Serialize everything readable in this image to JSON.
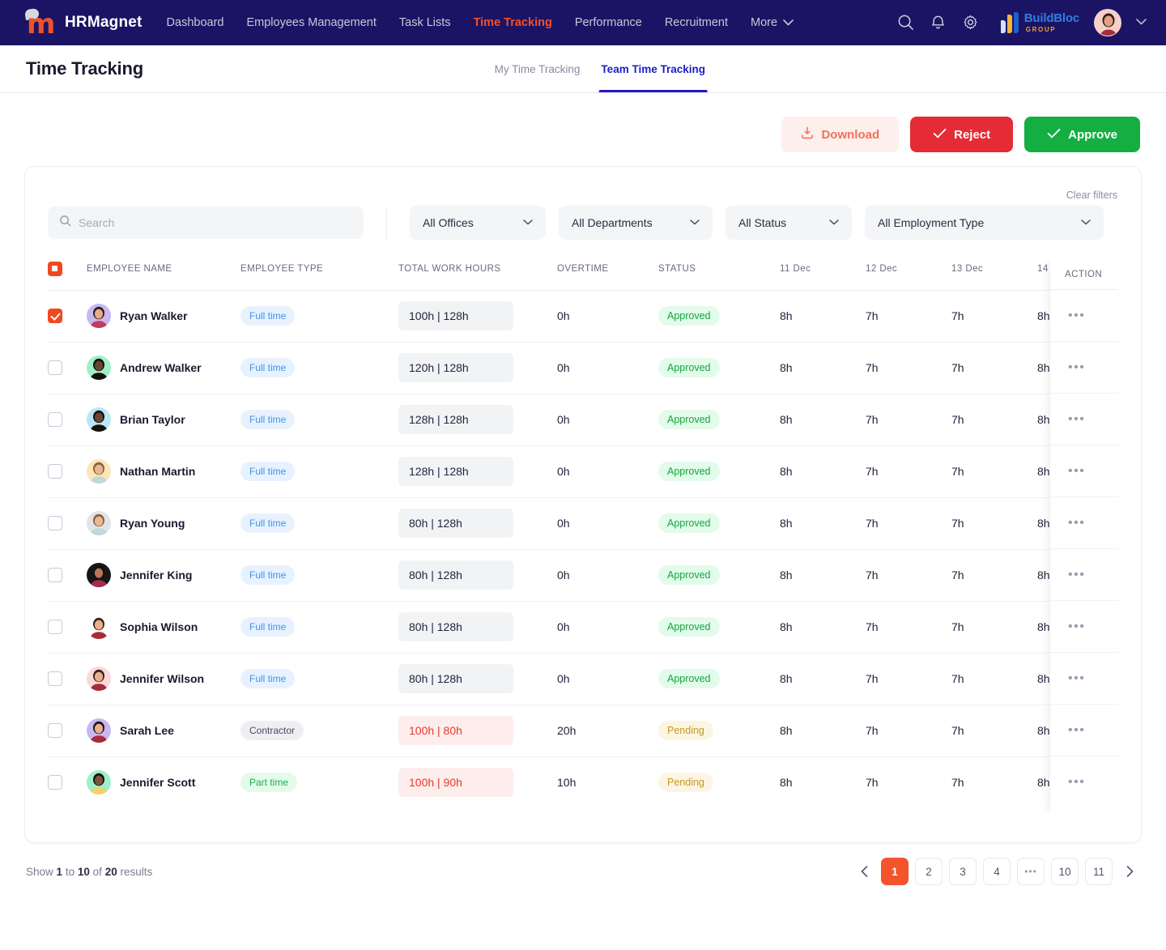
{
  "navbar": {
    "brand": "HRMagnet",
    "links": [
      {
        "label": "Dashboard",
        "active": false
      },
      {
        "label": "Employees Management",
        "active": false
      },
      {
        "label": "Task Lists",
        "active": false
      },
      {
        "label": "Time Tracking",
        "active": true
      },
      {
        "label": "Performance",
        "active": false
      },
      {
        "label": "Recruitment",
        "active": false
      }
    ],
    "more_label": "More",
    "org": {
      "name": "BuildBloc",
      "sub": "GROUP"
    },
    "accent": "#F0512C",
    "background": "#1B1464"
  },
  "page": {
    "title": "Time Tracking",
    "tabs": [
      {
        "label": "My Time Tracking",
        "active": false
      },
      {
        "label": "Team Time Tracking",
        "active": true
      }
    ]
  },
  "actions": {
    "download_label": "Download",
    "reject_label": "Reject",
    "approve_label": "Approve",
    "reject_color": "#E42B36",
    "approve_color": "#14AE43",
    "download_color": "#F2705A"
  },
  "filters": {
    "clear_label": "Clear filters",
    "search_placeholder": "Search",
    "search_value": "",
    "selects": [
      {
        "label": "All Offices"
      },
      {
        "label": "All Departments"
      },
      {
        "label": "All Status"
      },
      {
        "label": "All Employment Type"
      }
    ]
  },
  "table": {
    "columns": [
      "EMPLOYEE NAME",
      "EMPLOYEE TYPE",
      "TOTAL WORK HOURS",
      "OVERTIME",
      "STATUS",
      "11 Dec",
      "12 Dec",
      "13 Dec",
      "14"
    ],
    "action_column": "ACTION",
    "header_checkbox_state": "indeterminate",
    "rows": [
      {
        "selected": true,
        "name": "Ryan Walker",
        "type": "Full time",
        "type_style": "full",
        "hours": "100h | 128h",
        "hours_warn": false,
        "overtime": "0h",
        "status": "Approved",
        "status_style": "approved",
        "days": [
          "8h",
          "7h",
          "7h",
          "8h"
        ],
        "avatar_bg": "#C9B7F2",
        "skin": "#E8A98C",
        "hair": "#2B1B16",
        "shirt": "#C23A5E"
      },
      {
        "selected": false,
        "name": "Andrew Walker",
        "type": "Full time",
        "type_style": "full",
        "hours": "120h | 128h",
        "hours_warn": false,
        "overtime": "0h",
        "status": "Approved",
        "status_style": "approved",
        "days": [
          "8h",
          "7h",
          "7h",
          "8h"
        ],
        "avatar_bg": "#9FF0C8",
        "skin": "#6B4630",
        "hair": "#15100E",
        "shirt": "#15100E"
      },
      {
        "selected": false,
        "name": "Brian Taylor",
        "type": "Full time",
        "type_style": "full",
        "hours": "128h | 128h",
        "hours_warn": false,
        "overtime": "0h",
        "status": "Approved",
        "status_style": "approved",
        "days": [
          "8h",
          "7h",
          "7h",
          "8h"
        ],
        "avatar_bg": "#B9E7F5",
        "skin": "#6B4630",
        "hair": "#15100E",
        "shirt": "#15100E"
      },
      {
        "selected": false,
        "name": "Nathan Martin",
        "type": "Full time",
        "type_style": "full",
        "hours": "128h | 128h",
        "hours_warn": false,
        "overtime": "0h",
        "status": "Approved",
        "status_style": "approved",
        "days": [
          "8h",
          "7h",
          "7h",
          "8h"
        ],
        "avatar_bg": "#FCE5BB",
        "skin": "#E8B894",
        "hair": "#8C6239",
        "shirt": "#BCD9DC"
      },
      {
        "selected": false,
        "name": "Ryan Young",
        "type": "Full time",
        "type_style": "full",
        "hours": "80h | 128h",
        "hours_warn": false,
        "overtime": "0h",
        "status": "Approved",
        "status_style": "approved",
        "days": [
          "8h",
          "7h",
          "7h",
          "8h"
        ],
        "avatar_bg": "#E3E3E8",
        "skin": "#E8B894",
        "hair": "#8C6239",
        "shirt": "#BCD9DC"
      },
      {
        "selected": false,
        "name": "Jennifer King",
        "type": "Full time",
        "type_style": "full",
        "hours": "80h | 128h",
        "hours_warn": false,
        "overtime": "0h",
        "status": "Approved",
        "status_style": "approved",
        "days": [
          "8h",
          "7h",
          "7h",
          "8h"
        ],
        "avatar_bg": "#161616",
        "skin": "#B9765A",
        "hair": "#15100E",
        "shirt": "#A62C4D"
      },
      {
        "selected": false,
        "name": "Sophia Wilson",
        "type": "Full time",
        "type_style": "full",
        "hours": "80h | 128h",
        "hours_warn": false,
        "overtime": "0h",
        "status": "Approved",
        "status_style": "approved",
        "days": [
          "8h",
          "7h",
          "7h",
          "8h"
        ],
        "avatar_bg": "#FFFFFF",
        "skin": "#E8B08C",
        "hair": "#3A241C",
        "shirt": "#A62C3C"
      },
      {
        "selected": false,
        "name": "Jennifer Wilson",
        "type": "Full time",
        "type_style": "full",
        "hours": "80h | 128h",
        "hours_warn": false,
        "overtime": "0h",
        "status": "Approved",
        "status_style": "approved",
        "days": [
          "8h",
          "7h",
          "7h",
          "8h"
        ],
        "avatar_bg": "#FBD9DA",
        "skin": "#E8B08C",
        "hair": "#3A241C",
        "shirt": "#A62C3C"
      },
      {
        "selected": false,
        "name": "Sarah Lee",
        "type": "Contractor",
        "type_style": "contractor",
        "hours": "100h | 80h",
        "hours_warn": true,
        "overtime": "20h",
        "status": "Pending",
        "status_style": "pending",
        "days": [
          "8h",
          "7h",
          "7h",
          "8h"
        ],
        "avatar_bg": "#C9B7F2",
        "skin": "#E8B08C",
        "hair": "#1F1410",
        "shirt": "#A62C3C"
      },
      {
        "selected": false,
        "name": "Jennifer Scott",
        "type": "Part time",
        "type_style": "part",
        "hours": "100h | 90h",
        "hours_warn": true,
        "overtime": "10h",
        "status": "Pending",
        "status_style": "pending",
        "days": [
          "8h",
          "7h",
          "7h",
          "8h"
        ],
        "avatar_bg": "#9FF0C8",
        "skin": "#7E5339",
        "hair": "#15100E",
        "shirt": "#F2D06B"
      }
    ]
  },
  "footer": {
    "show_prefix": "Show",
    "from": "1",
    "to_word": "to",
    "to": "10",
    "of_word": "of",
    "total": "20",
    "results_word": "results",
    "pages": [
      "1",
      "2",
      "3",
      "4",
      "...",
      "10",
      "11"
    ],
    "active_page": "1",
    "active_color": "#F4542C"
  }
}
